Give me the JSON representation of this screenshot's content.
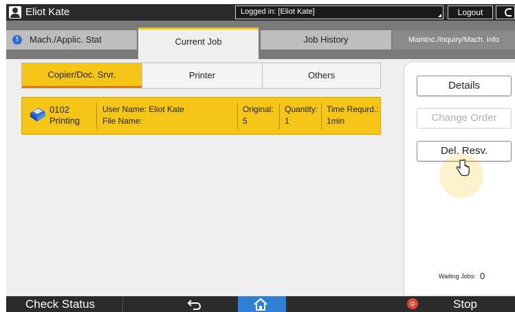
{
  "topbar": {
    "user_name": "Eliot Kate",
    "logged_in": "Logged in: [Eliot Kate]",
    "logout_label": "Logout",
    "icons": [
      "user-icon",
      "power-icon"
    ]
  },
  "tabs": [
    {
      "label": "Mach./Applic. Stat",
      "icon": "info-icon",
      "active": false
    },
    {
      "label": "Current Job",
      "active": true
    },
    {
      "label": "Job History",
      "active": false
    },
    {
      "label": "Maintnc./Inquiry/Mach. Info",
      "active": false
    }
  ],
  "segments": [
    {
      "label": "Copier/Doc. Srvr.",
      "active": true
    },
    {
      "label": "Printer",
      "active": false
    },
    {
      "label": "Others",
      "active": false
    }
  ],
  "job": {
    "number": "0102",
    "status": "Printing",
    "user_name": "User Name: Eliot Kate",
    "file_name": "File Name:",
    "original_label": "Original:",
    "original_value": "5",
    "quantity_label": "Quantity:",
    "quantity_value": "1",
    "time_label": "Time Requrd.:",
    "time_value": "1min",
    "icon": "copy-job-icon"
  },
  "actions": {
    "details": "Details",
    "change_order": "Change Order",
    "del_resv": "Del. Resv."
  },
  "waiting": {
    "label": "Waiting Jobs:",
    "value": "0"
  },
  "bottom": {
    "check_status": "Check Status",
    "stop": "Stop",
    "icons": [
      "back-icon",
      "home-icon",
      "stop-icon"
    ]
  },
  "colors": {
    "accent_yellow": "#f5c518",
    "accent_orange": "#e07a10",
    "home_blue": "#2f7fd6",
    "stop_red": "#e0463a",
    "bar_dark": "#2b2b2b"
  }
}
